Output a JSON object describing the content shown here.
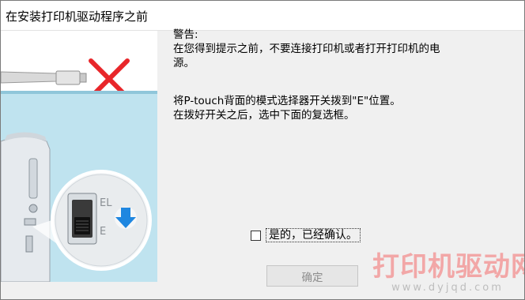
{
  "dialog": {
    "title": "在安装打印机驱动程序之前",
    "message": {
      "warning_heading": "警告:",
      "warning_line1": "在您得到提示之前，不要连接打印机或者打开打印机的电",
      "warning_line2": "源。",
      "instruction_line1": "将P-touch背面的模式选择器开关拨到\"E\"位置。",
      "instruction_line2": "在拨好开关之后，选中下面的复选框。"
    },
    "illustration": {
      "switch_label_el": "EL",
      "switch_label_e": "E"
    },
    "confirm_checkbox": {
      "label": "是的，已经确认。",
      "checked": false
    },
    "ok_button": {
      "label": "确定",
      "enabled": false
    }
  },
  "watermark": {
    "text": "打印机驱动网",
    "url": "www.dyjqd.com"
  },
  "colors": {
    "dialog_background": "#f0f0f0",
    "cross_red": "#e8262a",
    "arrow_blue": "#1f87e0",
    "panel_blue": "#bfe3ef",
    "watermark_red": "#f2a7a7"
  }
}
